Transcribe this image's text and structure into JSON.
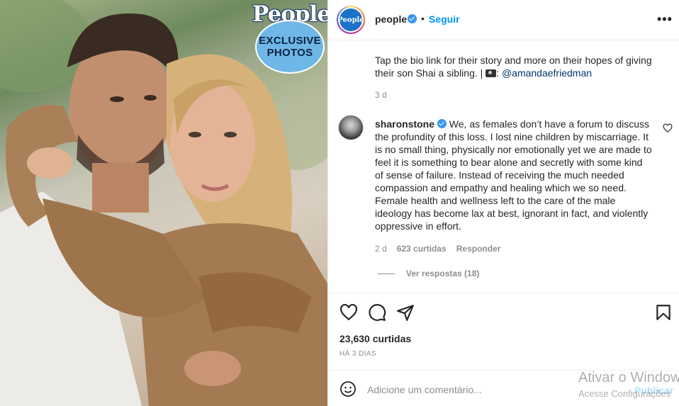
{
  "image": {
    "badge_logo": "People",
    "badge_text_1": "EXCLUSIVE",
    "badge_text_2": "PHOTOS"
  },
  "header": {
    "avatar_text": "People",
    "username": "people",
    "separator": "•",
    "follow_label": "Seguir",
    "more_label": "•••"
  },
  "caption": {
    "text": "Tap the bio link for their story and more on their hopes of giving their son Shai a sibling. | ",
    "mention_prefix": ":",
    "mention": "@amandaefriedman",
    "time": "3 d"
  },
  "comment": {
    "username": "sharonstone",
    "text": "We, as females don’t have a forum to discuss the profundity of this loss. I lost nine children by miscarriage. It is no small thing, physically nor emotionally yet we are made to feel it is something to bear alone and secretly with some kind of sense of failure. Instead of receiving the much needed compassion and empathy and healing which we so need. Female health and wellness left to the care of the male ideology has become lax at best, ignorant in fact, and violently oppressive in effort.",
    "time": "2 d",
    "likes": "623 curtidas",
    "reply_label": "Responder",
    "view_replies": "Ver respostas (18)"
  },
  "post": {
    "likes": "23,630 curtidas",
    "posted_ago": "HÁ 3 DIAS"
  },
  "add_comment": {
    "placeholder": "Adicione um comentário...",
    "post_label": "Publicar"
  },
  "overlay": {
    "activate_title": "Ativar o Windows",
    "activate_sub": "Acesse Configurações"
  },
  "colors": {
    "link_blue": "#0095f6",
    "mention_blue": "#00376b",
    "muted": "#8e8e8e",
    "sweater": "#a47a52"
  }
}
